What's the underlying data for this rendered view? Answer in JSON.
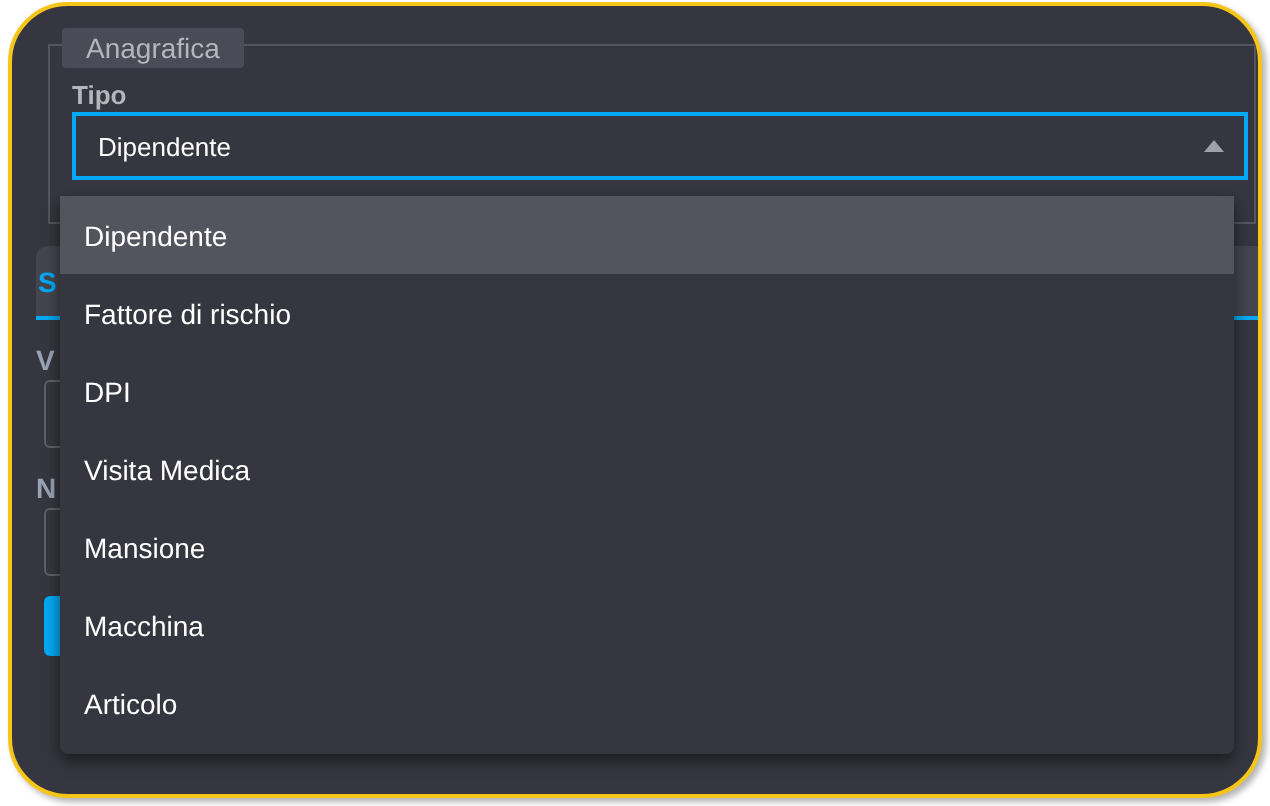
{
  "fieldset": {
    "legend": "Anagrafica",
    "label": "Tipo",
    "value": "Dipendente",
    "expanded": true
  },
  "background": {
    "tab": "S",
    "field_labels": [
      "V",
      "N"
    ]
  },
  "options": [
    {
      "label": "Dipendente",
      "selected": true
    },
    {
      "label": "Fattore di rischio",
      "selected": false
    },
    {
      "label": "DPI",
      "selected": false
    },
    {
      "label": "Visita Medica",
      "selected": false
    },
    {
      "label": "Mansione",
      "selected": false
    },
    {
      "label": "Macchina",
      "selected": false
    },
    {
      "label": "Articolo",
      "selected": false
    }
  ]
}
